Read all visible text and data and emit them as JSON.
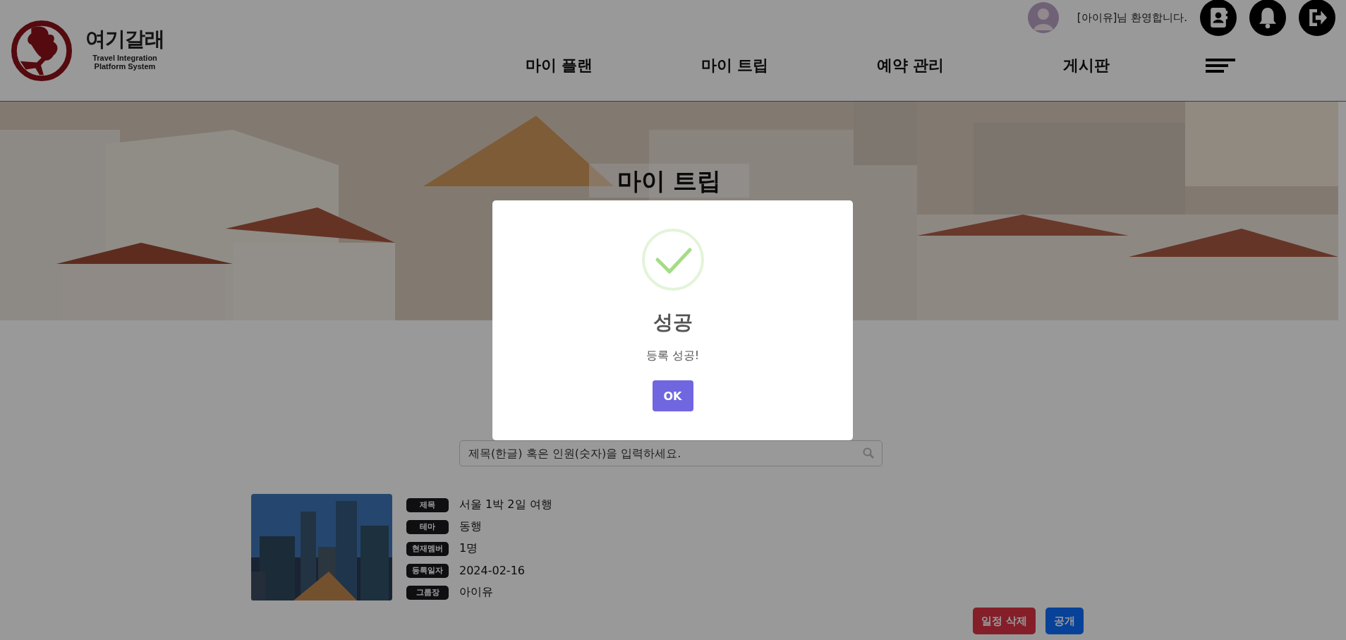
{
  "header": {
    "logo": {
      "title": "여기갈래",
      "subtitle_line_1": "Travel Integration",
      "subtitle_line_2": "Platform System"
    },
    "user": {
      "greeting": "[아이유]님 환영합니다."
    },
    "nav": [
      "마이 플랜",
      "마이 트립",
      "예약 관리",
      "게시판"
    ]
  },
  "banner": {
    "title": "마이 트립"
  },
  "search": {
    "placeholder": "제목(한글) 혹은 인원(숫자)을 입력하세요."
  },
  "trips": [
    {
      "fields": [
        {
          "label": "제목",
          "value": "서울 1박 2일 여행"
        },
        {
          "label": "테마",
          "value": "동행"
        },
        {
          "label": "현재멤버",
          "value": "1명"
        },
        {
          "label": "등록일자",
          "value": "2024-02-16"
        },
        {
          "label": "그룹장",
          "value": "아이유"
        }
      ]
    }
  ],
  "actions": [
    {
      "label": "일정 삭제",
      "kind": "danger"
    },
    {
      "label": "공개",
      "kind": "primary"
    }
  ],
  "dialog": {
    "kind": "success",
    "title": "성공",
    "message": "등록 성공!",
    "button": "OK"
  }
}
